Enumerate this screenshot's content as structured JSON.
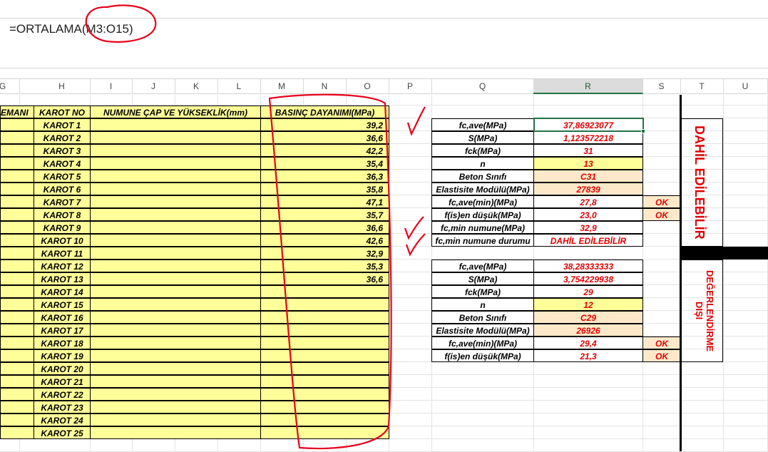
{
  "formula": "=ORTALAMA(M3:O15)",
  "columns": [
    "G",
    "H",
    "I",
    "J",
    "K",
    "L",
    "M",
    "N",
    "O",
    "P",
    "Q",
    "R",
    "S",
    "T",
    "U"
  ],
  "selected_column": "R",
  "headers": {
    "eleman": "EMANI",
    "karot_no": "KAROT NO",
    "numune": "NUMUNE ÇAP VE YÜKSEKLİK(mm)",
    "basinc": "BASINÇ DAYANIMI(MPa)"
  },
  "karot_rows": [
    {
      "name": "KAROT 1",
      "value": "39,2"
    },
    {
      "name": "KAROT 2",
      "value": "36,6"
    },
    {
      "name": "KAROT 3",
      "value": "42,2"
    },
    {
      "name": "KAROT 4",
      "value": "35,4"
    },
    {
      "name": "KAROT 5",
      "value": "36,3"
    },
    {
      "name": "KAROT 6",
      "value": "35,8"
    },
    {
      "name": "KAROT 7",
      "value": "47,1"
    },
    {
      "name": "KAROT 8",
      "value": "35,7"
    },
    {
      "name": "KAROT 9",
      "value": "36,6"
    },
    {
      "name": "KAROT 10",
      "value": "42,6"
    },
    {
      "name": "KAROT 11",
      "value": "32,9"
    },
    {
      "name": "KAROT 12",
      "value": "35,3"
    },
    {
      "name": "KAROT 13",
      "value": "36,6"
    },
    {
      "name": "KAROT 14",
      "value": ""
    },
    {
      "name": "KAROT 15",
      "value": ""
    },
    {
      "name": "KAROT 16",
      "value": ""
    },
    {
      "name": "KAROT 17",
      "value": ""
    },
    {
      "name": "KAROT 18",
      "value": ""
    },
    {
      "name": "KAROT 19",
      "value": ""
    },
    {
      "name": "KAROT 20",
      "value": ""
    },
    {
      "name": "KAROT 21",
      "value": ""
    },
    {
      "name": "KAROT 22",
      "value": ""
    },
    {
      "name": "KAROT 23",
      "value": ""
    },
    {
      "name": "KAROT 24",
      "value": ""
    },
    {
      "name": "KAROT 25",
      "value": ""
    }
  ],
  "stats_included": [
    {
      "label": "fc,ave(MPa)",
      "value": "37,86923077",
      "fill": "none",
      "check": ""
    },
    {
      "label": "S(MPa)",
      "value": "1,123572218",
      "fill": "none",
      "check": ""
    },
    {
      "label": "fck(MPa)",
      "value": "31",
      "fill": "none",
      "check": ""
    },
    {
      "label": "n",
      "value": "13",
      "fill": "yellow",
      "check": ""
    },
    {
      "label": "Beton Sınıfı",
      "value": "C31",
      "fill": "peach",
      "check": ""
    },
    {
      "label": "Elastisite Modülü(MPa)",
      "value": "27839",
      "fill": "peach",
      "check": ""
    },
    {
      "label": "fc,ave(min)(MPa)",
      "value": "27,8",
      "fill": "none",
      "check": "OK"
    },
    {
      "label": "f(is)en düşük(MPa)",
      "value": "23,0",
      "fill": "none",
      "check": "OK"
    },
    {
      "label": "fc,min numune(MPa)",
      "value": "32,9",
      "fill": "none",
      "check": ""
    },
    {
      "label": "fc,min numune durumu",
      "value": "DAHİL EDİLEBİLİR",
      "fill": "none",
      "check": ""
    }
  ],
  "stats_excluded": [
    {
      "label": "fc,ave(MPa)",
      "value": "38,28333333",
      "fill": "none",
      "check": ""
    },
    {
      "label": "S(MPa)",
      "value": "3,754229938",
      "fill": "none",
      "check": ""
    },
    {
      "label": "fck(MPa)",
      "value": "29",
      "fill": "none",
      "check": ""
    },
    {
      "label": "n",
      "value": "12",
      "fill": "yellow",
      "check": ""
    },
    {
      "label": "Beton Sınıfı",
      "value": "C29",
      "fill": "peach",
      "check": ""
    },
    {
      "label": "Elastisite Modülü(MPa)",
      "value": "26926",
      "fill": "peach",
      "check": ""
    },
    {
      "label": "fc,ave(min)(MPa)",
      "value": "29,4",
      "fill": "none",
      "check": "OK"
    },
    {
      "label": "f(is)en düşük(MPa)",
      "value": "21,3",
      "fill": "none",
      "check": "OK"
    }
  ],
  "side_labels": {
    "included": "DAHİL EDİLEBİLİR",
    "excluded": "DEĞERLENDİRME DIŞI"
  },
  "colors": {
    "accent_red": "#e00000",
    "cell_yellow": "#ffff99",
    "cell_peach": "#fde9c9",
    "excel_green": "#217346"
  }
}
